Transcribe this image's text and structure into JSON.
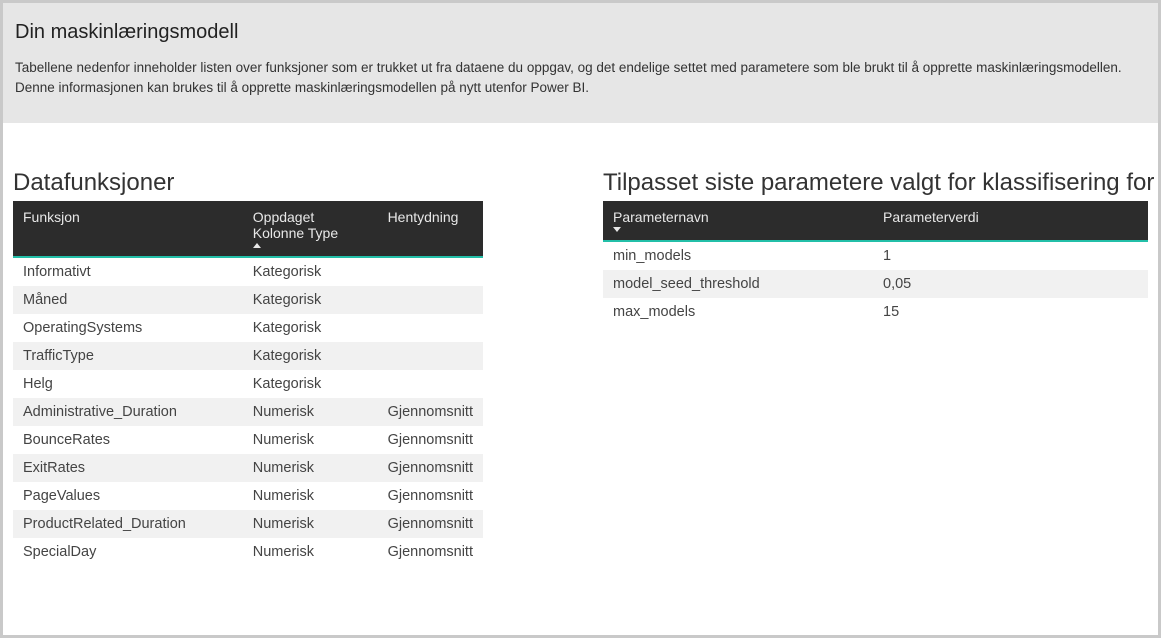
{
  "header": {
    "title": "Din maskinlæringsmodell",
    "description": "Tabellene nedenfor inneholder listen over funksjoner som er trukket ut fra dataene du oppgav, og det endelige settet med parametere som ble brukt til å opprette maskinlæringsmodellen. Denne informasjonen kan brukes til å opprette maskinlæringsmodellen på nytt utenfor Power BI."
  },
  "features": {
    "title": "Datafunksjoner",
    "columns": {
      "func": "Funksjon",
      "type": "Oppdaget Kolonne Type",
      "hint": "Hentydning"
    },
    "rows": [
      {
        "func": "Informativt",
        "type": "Kategorisk",
        "hint": "",
        "funcMuted": false,
        "alt": false
      },
      {
        "func": "Måned",
        "type": "Kategorisk",
        "hint": "",
        "funcMuted": true,
        "alt": true
      },
      {
        "func": "OperatingSystems",
        "type": "Kategorisk",
        "hint": "",
        "funcMuted": false,
        "alt": false
      },
      {
        "func": "TrafficType",
        "type": "Kategorisk",
        "hint": "",
        "funcMuted": false,
        "alt": true
      },
      {
        "func": "Helg",
        "type": "Kategorisk",
        "hint": "",
        "funcMuted": false,
        "alt": false
      },
      {
        "func": "Administrative_Duration",
        "type": "Numerisk",
        "hint": "Gjennomsnitt",
        "funcMuted": false,
        "alt": true
      },
      {
        "func": "BounceRates",
        "type": "Numerisk",
        "hint": "Gjennomsnitt",
        "funcMuted": false,
        "alt": false
      },
      {
        "func": "ExitRates",
        "type": "Numerisk",
        "hint": "Gjennomsnitt",
        "funcMuted": false,
        "alt": true
      },
      {
        "func": "PageValues",
        "type": "Numerisk",
        "hint": "Gjennomsnitt",
        "funcMuted": false,
        "alt": false
      },
      {
        "func": "ProductRelated_Duration",
        "type": "Numerisk",
        "hint": "Gjennomsnitt",
        "funcMuted": false,
        "alt": true
      },
      {
        "func": "SpecialDay",
        "type": "Numerisk",
        "hint": "Gjennomsnitt",
        "funcMuted": false,
        "alt": false
      }
    ]
  },
  "params": {
    "title": "Tilpasset siste parametere valgt for klassifisering for myk stem",
    "columns": {
      "name": "Parameternavn",
      "value": "Parameterverdi"
    },
    "rows": [
      {
        "name": "min_models",
        "value": "1",
        "alt": false,
        "valSmall": false
      },
      {
        "name": "model_seed_threshold",
        "value": "0,05",
        "alt": true,
        "valSmall": true
      },
      {
        "name": "max_models",
        "value": "15",
        "alt": false,
        "valSmall": false
      }
    ]
  }
}
